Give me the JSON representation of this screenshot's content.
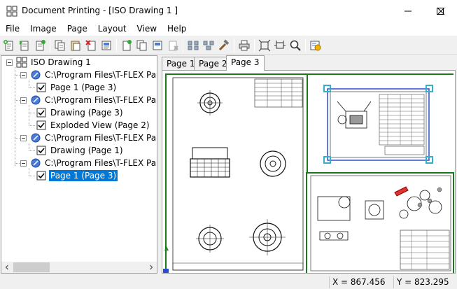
{
  "window": {
    "title": "Document Printing - [ISO Drawing 1 ]",
    "controls": [
      "minimize",
      "maximize",
      "close"
    ]
  },
  "menu": [
    "File",
    "Image",
    "Page",
    "Layout",
    "View",
    "Help"
  ],
  "toolbar": {
    "icons": [
      "new-page-icon",
      "insert-page-icon",
      "add-page-icon",
      "copy-page-icon",
      "paste-page-icon",
      "delete-page-icon",
      "page-properties-icon",
      "new-document-icon",
      "copy-document-icon",
      "document-properties-icon",
      "remove-document-icon",
      "align-icon",
      "distribute-icon",
      "tools-icon",
      "print-icon",
      "fit-page-icon",
      "fit-width-icon",
      "zoom-icon",
      "settings-icon"
    ]
  },
  "tree": {
    "root": "ISO Drawing 1",
    "nodes": [
      {
        "label": "C:\\Program Files\\T-FLEX Parametric",
        "children": [
          "Page 1 (Page 3)"
        ]
      },
      {
        "label": "C:\\Program Files\\T-FLEX Parametric",
        "children": [
          "Drawing (Page 3)",
          "Exploded View (Page 2)"
        ]
      },
      {
        "label": "C:\\Program Files\\T-FLEX Parametric",
        "children": [
          "Drawing (Page 1)"
        ]
      },
      {
        "label": "C:\\Program Files\\T-FLEX Parametric",
        "children": [
          "Page 1 (Page 3)"
        ]
      }
    ],
    "selected": "Page 1 (Page 3)"
  },
  "tabs": [
    {
      "label": "Page 1",
      "active": false
    },
    {
      "label": "Page 2",
      "active": false
    },
    {
      "label": "Page 3",
      "active": true
    }
  ],
  "status": {
    "empty": "",
    "x": "X = 867.456",
    "y": "Y = 823.295"
  },
  "colors": {
    "selection": "#0078d7",
    "frame_green": "#1a7a1a",
    "handle_cyan": "#36b0c8",
    "selection_blue": "#2a4fd0"
  }
}
